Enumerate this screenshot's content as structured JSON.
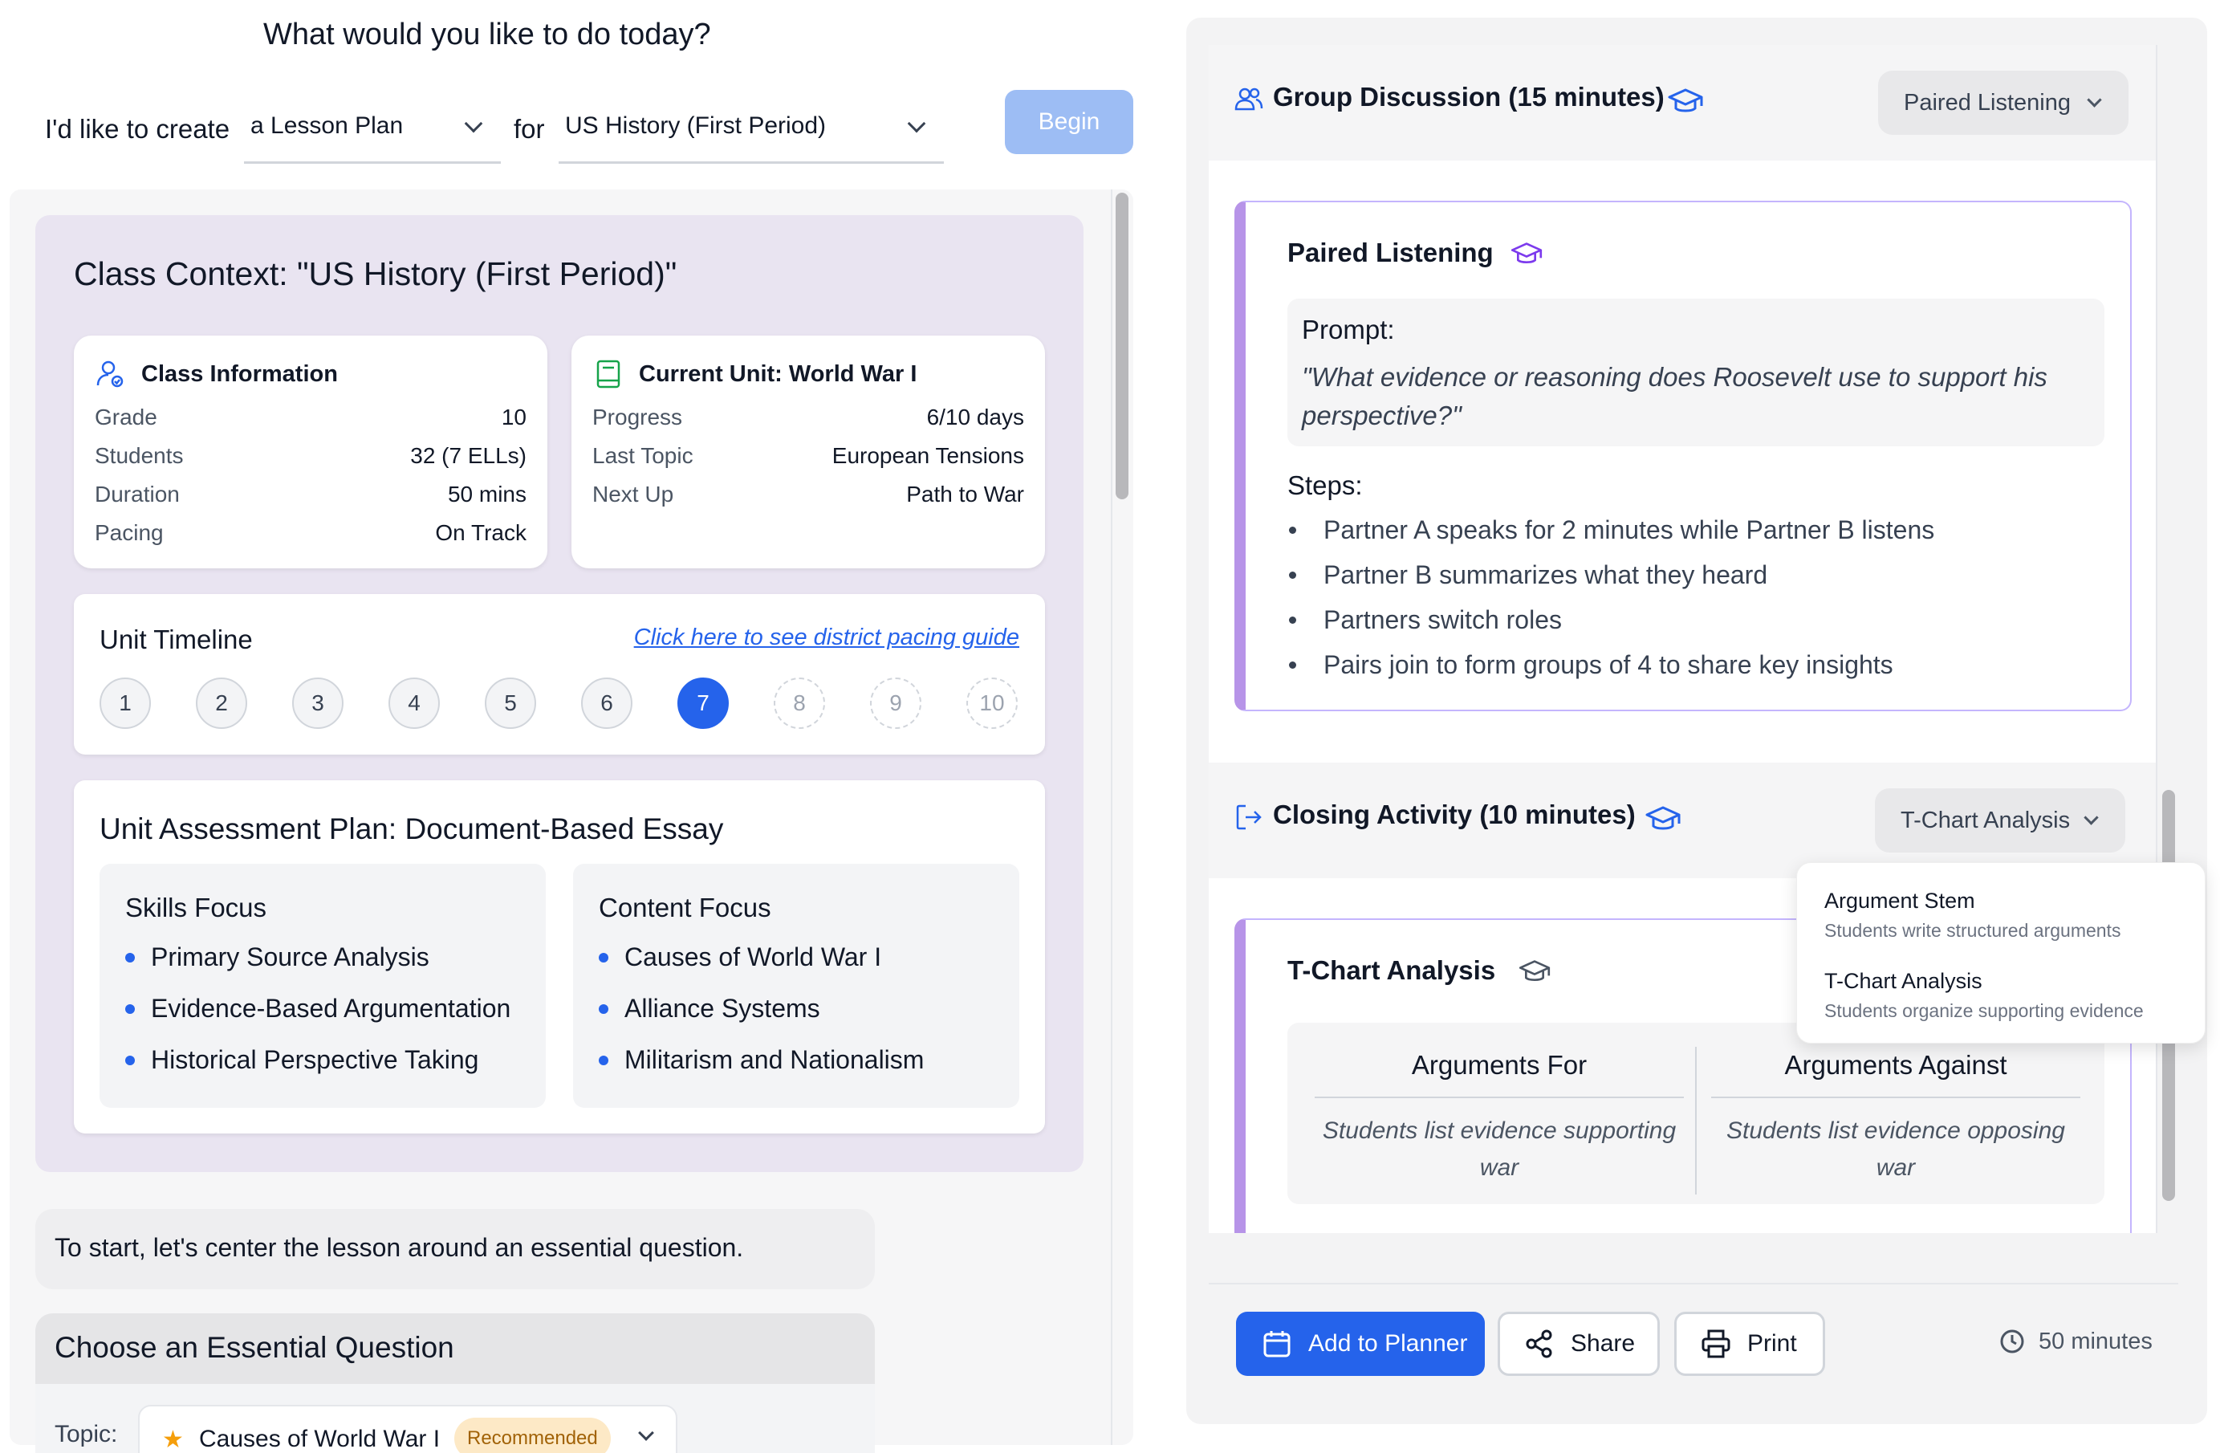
{
  "header": {
    "prompt": "What would you like to do today?",
    "create_label": "I'd like to create",
    "create_value": "a Lesson Plan",
    "for_label": "for",
    "class_value": "US History (First Period)",
    "begin_label": "Begin"
  },
  "context": {
    "title": "Class Context: \"US History (First Period)\"",
    "class_info": {
      "title": "Class Information",
      "rows": [
        {
          "k": "Grade",
          "v": "10"
        },
        {
          "k": "Students",
          "v": "32 (7 ELLs)"
        },
        {
          "k": "Duration",
          "v": "50 mins"
        },
        {
          "k": "Pacing",
          "v": "On Track"
        }
      ]
    },
    "unit": {
      "title": "Current Unit: World War I",
      "rows": [
        {
          "k": "Progress",
          "v": "6/10 days"
        },
        {
          "k": "Last Topic",
          "v": "European Tensions"
        },
        {
          "k": "Next Up",
          "v": "Path to War"
        }
      ]
    },
    "timeline": {
      "title": "Unit Timeline",
      "link": "Click here to see district pacing guide",
      "steps": [
        "1",
        "2",
        "3",
        "4",
        "5",
        "6",
        "7",
        "8",
        "9",
        "10"
      ],
      "current": 7
    },
    "assessment": {
      "title": "Unit Assessment Plan: Document-Based Essay",
      "skills_title": "Skills Focus",
      "skills": [
        "Primary Source Analysis",
        "Evidence-Based Argumentation",
        "Historical Perspective Taking"
      ],
      "content_title": "Content Focus",
      "content": [
        "Causes of World War I",
        "Alliance Systems",
        "Militarism and Nationalism"
      ]
    }
  },
  "chat": {
    "message": "To start, let's center the lesson around an essential question."
  },
  "essential_question": {
    "title": "Choose an Essential Question",
    "topic_label": "Topic:",
    "topic_value": "Causes of World War I",
    "badge": "Recommended"
  },
  "plan": {
    "group": {
      "title": "Group Discussion (15 minutes)",
      "dropdown": "Paired Listening",
      "activity_title": "Paired Listening",
      "prompt_label": "Prompt:",
      "prompt_line1": "\"What evidence or reasoning does Roosevelt use to support his",
      "prompt_line2": "perspective?\"",
      "steps_label": "Steps:",
      "steps": [
        "Partner A speaks for 2 minutes while Partner B listens",
        "Partner B summarizes what they heard",
        "Partners switch roles",
        "Pairs join to form groups of 4 to share key insights"
      ]
    },
    "closing": {
      "title": "Closing Activity (10 minutes)",
      "dropdown": "T-Chart Analysis",
      "activity_title": "T-Chart Analysis",
      "for_head": "Arguments For",
      "for_body1": "Students list evidence supporting",
      "for_body2": "war",
      "against_head": "Arguments Against",
      "against_body1": "Students list evidence opposing",
      "against_body2": "war"
    },
    "popup": [
      {
        "title": "Argument Stem",
        "desc": "Students write structured arguments"
      },
      {
        "title": "T-Chart Analysis",
        "desc": "Students organize supporting evidence"
      }
    ]
  },
  "footer": {
    "add_label": "Add to Planner",
    "share_label": "Share",
    "print_label": "Print",
    "duration": "50 minutes"
  },
  "colors": {
    "accent": "#2563eb",
    "context_bg": "#e9e4f1",
    "activity_border": "#b794e8"
  },
  "icons": [
    "user-icon",
    "book-icon",
    "users-icon",
    "graduation-cap-icon",
    "logout-icon",
    "calendar-icon",
    "share-icon",
    "printer-icon",
    "clock-icon",
    "star-icon",
    "chevron-down-icon"
  ]
}
